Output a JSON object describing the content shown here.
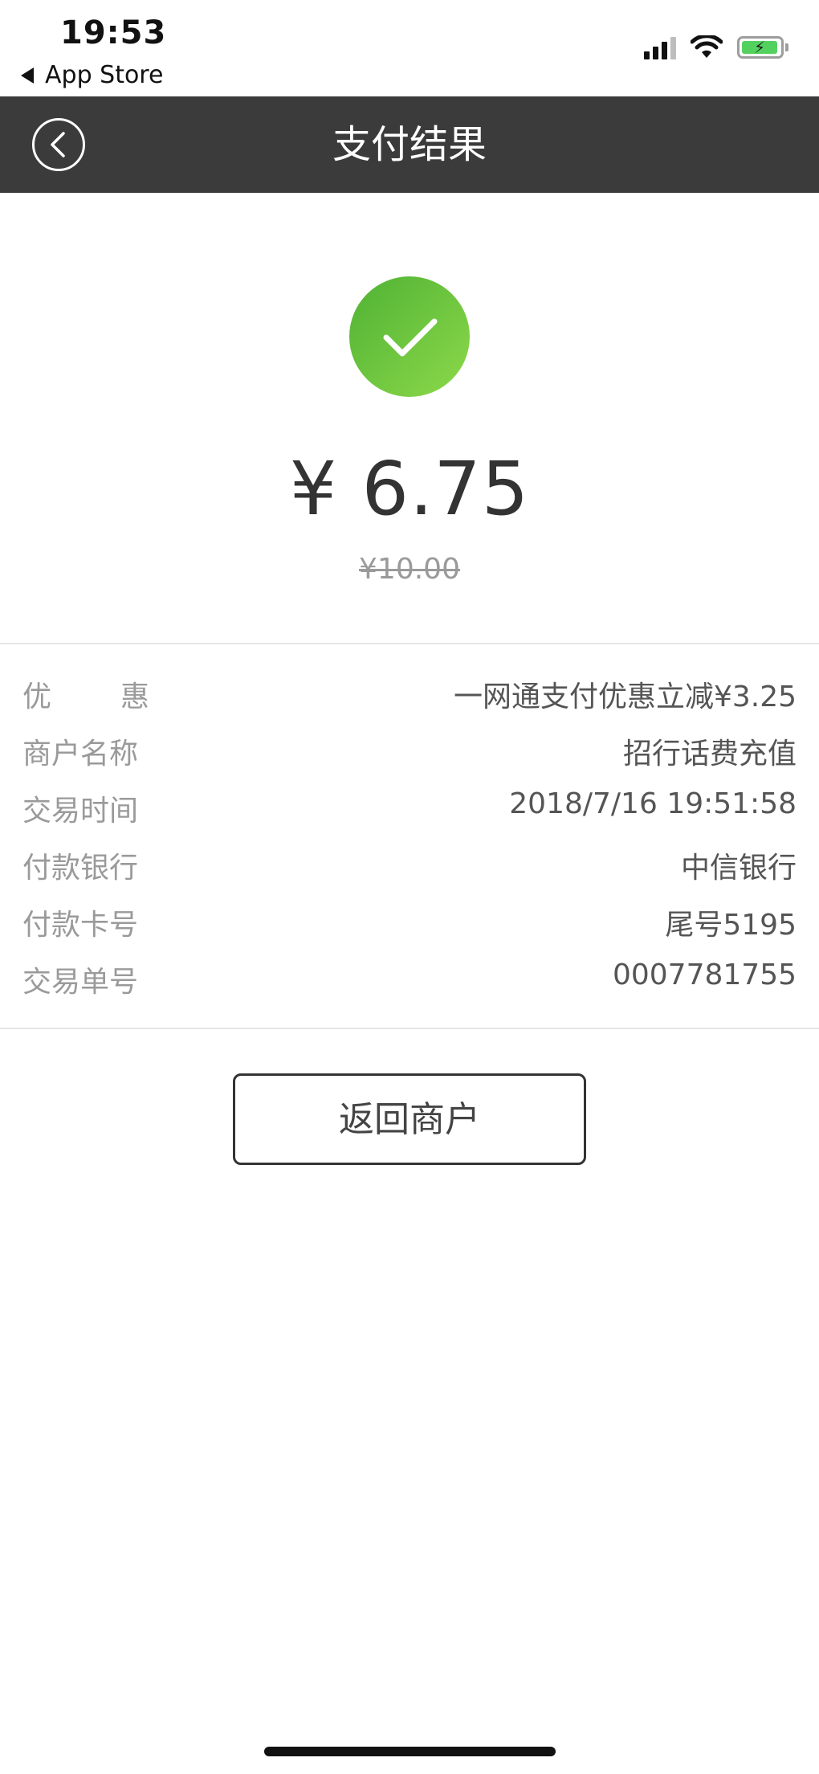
{
  "status_bar": {
    "time": "19:53",
    "back_app": "App Store",
    "icons": [
      "cellular-signal-icon",
      "wifi-icon",
      "battery-charging-icon"
    ]
  },
  "header": {
    "title": "支付结果",
    "back_icon": "chevron-left-circle-icon"
  },
  "result": {
    "status_icon": "check-circle-icon",
    "status_color": "#5cbf38",
    "amount": "¥ 6.75",
    "original_amount": "¥10.00"
  },
  "details": [
    {
      "label_chars": [
        "优",
        "惠"
      ],
      "value": "一网通支付优惠立减¥3.25"
    },
    {
      "label": "商户名称",
      "value": "招行话费充值"
    },
    {
      "label": "交易时间",
      "value": "2018/7/16 19:51:58"
    },
    {
      "label": "付款银行",
      "value": "中信银行"
    },
    {
      "label": "付款卡号",
      "value": "尾号5195"
    },
    {
      "label": "交易单号",
      "value": "0007781755"
    }
  ],
  "actions": {
    "return_label": "返回商户"
  },
  "colors": {
    "header_bg": "#3b3b3b",
    "success_green": "#5cbf38"
  }
}
